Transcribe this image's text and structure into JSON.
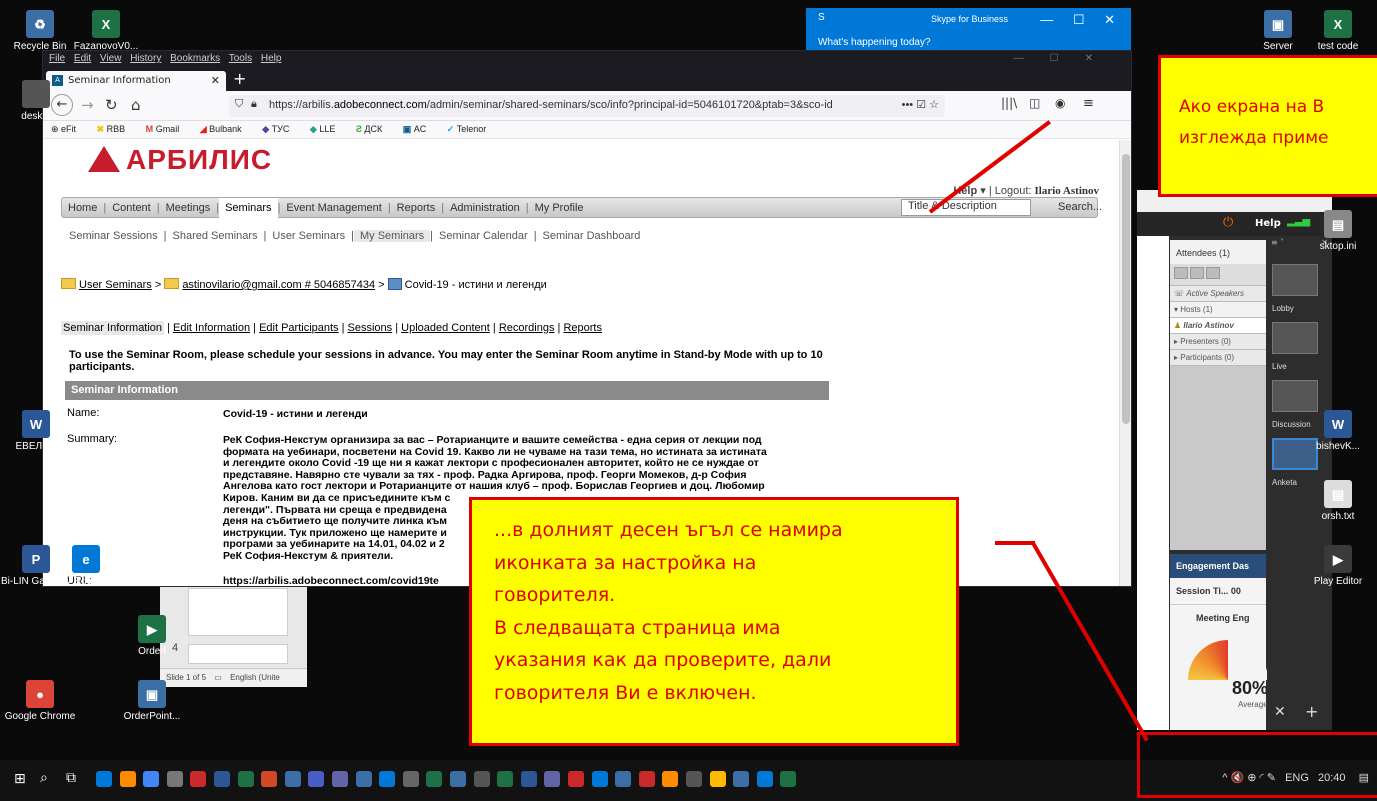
{
  "desktop": {
    "icons_left": [
      {
        "label": "Recycle Bin",
        "color": "#3a6ea5",
        "glyph": "♻"
      },
      {
        "label": "FazanovoV0...",
        "color": "#1e7145",
        "glyph": "X"
      },
      {
        "label": "deskto",
        "color": "#555555",
        "glyph": ""
      },
      {
        "label": "ЕВЕЛИН",
        "color": "#2b5797",
        "glyph": "W"
      },
      {
        "label": "Bi-LIN Gateway",
        "color": "#2b5797",
        "glyph": "P"
      },
      {
        "label": "Edge",
        "color": "#0078d7",
        "glyph": "e"
      },
      {
        "label": "Orderl",
        "color": "#1e7145",
        "glyph": "▶"
      },
      {
        "label": "Google Chrome",
        "color": "#db4437",
        "glyph": "●"
      },
      {
        "label": "OrderPoint...",
        "color": "#3a6ea5",
        "glyph": "▣"
      }
    ],
    "icons_right": [
      {
        "label": "Server",
        "color": "#3a6ea5",
        "glyph": "▣"
      },
      {
        "label": "test code",
        "color": "#1e7145",
        "glyph": "X"
      },
      {
        "label": "sktop.ini",
        "color": "#888888",
        "glyph": "▤"
      },
      {
        "label": "bishevK...",
        "color": "#2b5797",
        "glyph": "W"
      },
      {
        "label": "orsh.txt",
        "color": "#dddddd",
        "glyph": "▤"
      },
      {
        "label": "Play Editor",
        "color": "#3a3a3a",
        "glyph": "▶"
      }
    ]
  },
  "skype": {
    "title": "Skype for Business",
    "status": "What's happening today?",
    "s_icon": "S",
    "controls": "— ☐ ✕"
  },
  "browser": {
    "menu": [
      "File",
      "Edit",
      "View",
      "History",
      "Bookmarks",
      "Tools",
      "Help"
    ],
    "tab_title": "Seminar Information",
    "tab_close": "✕",
    "new_tab": "+",
    "url_prefix": "https://arbilis.",
    "url_host": "adobeconnect.com",
    "url_path": "/admin/seminar/shared-seminars/sco/info?principal-id=5046101720&ptab=3&sco-id",
    "url_tools": "••• ☑ ☆",
    "bookmarks": [
      "eFit",
      "RBB",
      "Gmail",
      "Bulbank",
      "ТУС",
      "LLE",
      "ДСК",
      "AC",
      "Telenor"
    ]
  },
  "site": {
    "logo": "АРБИЛИС",
    "help": "Help",
    "logout_label": "Logout:",
    "user": "Ilario Astinov",
    "main_nav": [
      "Home",
      "Content",
      "Meetings",
      "Seminars",
      "Event Management",
      "Reports",
      "Administration",
      "My Profile"
    ],
    "main_nav_active": "Seminars",
    "search_placeholder": "Title & Description",
    "search_button": "Search...",
    "sub_nav": [
      "Seminar Sessions",
      "Shared Seminars",
      "User Seminars",
      "My Seminars",
      "Seminar Calendar",
      "Seminar Dashboard"
    ],
    "sub_nav_active": "My Seminars",
    "crumb1": "User Seminars",
    "crumb2": "astinovilario@gmail.com # 5046857434",
    "crumb3": "Covid-19 - истини и легенди",
    "crumb_sep": ">",
    "info_tabs": [
      "Seminar Information",
      "Edit Information",
      "Edit Participants",
      "Sessions",
      "Uploaded Content",
      "Recordings",
      "Reports"
    ],
    "notice": "To use the Seminar Room, please schedule your sessions in advance. You may enter the Seminar Room anytime in Stand-by Mode with up to 10 participants.",
    "info_header": "Seminar Information",
    "name_label": "Name:",
    "name_value": "Covid-19 - истини и легенди",
    "summary_label": "Summary:",
    "summary_lines": [
      "РеК София-Некстум организира за вас – Ротарианците и вашите семейства - една серия от лекции под",
      "формата на уебинари, посветени на Covid 19. Какво ли не чуваме на тази тема, но истината за истината",
      "и легендите около Covid -19 ще ни я кажат лектори с професионален авторитет, който не се нуждае от",
      "представяне. Навярно сте чували за тях - проф. Радка Аргирова, проф. Георги Момеков, д-р София",
      "Ангелова като гост лектори и Ротарианците от нашия клуб – проф. Борислав Георгиев и доц. Любомир",
      "Киров. Каним ви да се присъедините към с",
      "легенди\". Първата ни среща е предвидена",
      "деня на събитието ще получите линка към",
      "инструкции. Тук приложено ще намерите и",
      "програми за уебинарите на 14.01, 04.02 и 2",
      "РеК София-Некстум & приятели."
    ],
    "url_label": "URL:",
    "url_value": "https://arbilis.adobeconnect.com/covid19te"
  },
  "connect": {
    "help": "Help",
    "attendees_title": "Attendees",
    "attendees_count": "(1)",
    "active_speakers": "Active Speakers",
    "hosts": "Hosts (1)",
    "host_name": "Ilario Astinov",
    "presenters": "Presenters (0)",
    "participants": "Participants (0)",
    "engagement_title": "Engagement Das",
    "session_time": "Session Ti...",
    "session_time_value": "00",
    "meeting_eng": "Meeting Eng",
    "meeting_pct": "80%",
    "average": "Average",
    "layouts": [
      "Lobby",
      "Live",
      "Discussion",
      "Anketa"
    ],
    "layout_active": "Anketa"
  },
  "ppt": {
    "slide_num": "4",
    "status": "Slide 1 of 5",
    "lang": "English (Unite"
  },
  "callouts": {
    "top_line1": "Ако екрана на В",
    "top_line2": "изглежда приме",
    "bottom_lines": [
      "...в долният десен ъгъл се намира",
      "иконката за настройка на",
      "говорителя.",
      "В следващата страница има",
      "указания как да проверите, дали",
      "говорителя Ви е включен."
    ],
    "color": "#e00000",
    "fill": "#ffff00"
  },
  "taskbar": {
    "tray_lang": "ENG",
    "tray_time": "20:40",
    "tray_icons": "^  🔇  ⊕  ◜  ✎"
  }
}
